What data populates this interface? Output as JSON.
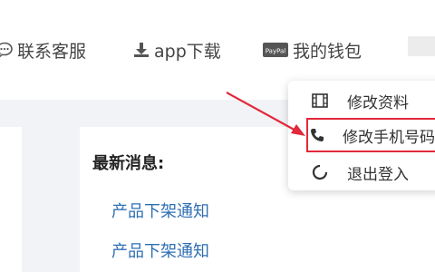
{
  "nav": {
    "service_label": "联系客服",
    "download_label": "app下载",
    "wallet_label": "我的钱包",
    "paypal_text": "PayPal"
  },
  "news": {
    "title": "最新消息:",
    "links": [
      "产品下架通知",
      "产品下架通知"
    ]
  },
  "dropdown": {
    "items": [
      {
        "label": "修改资料",
        "icon": "film-icon"
      },
      {
        "label": "修改手机号码",
        "icon": "phone-icon"
      },
      {
        "label": "退出登入",
        "icon": "spinner-icon"
      }
    ]
  },
  "colors": {
    "accent_red": "#e2283a",
    "link_blue": "#2f6fb2",
    "page_bg": "#f2f3f6"
  }
}
